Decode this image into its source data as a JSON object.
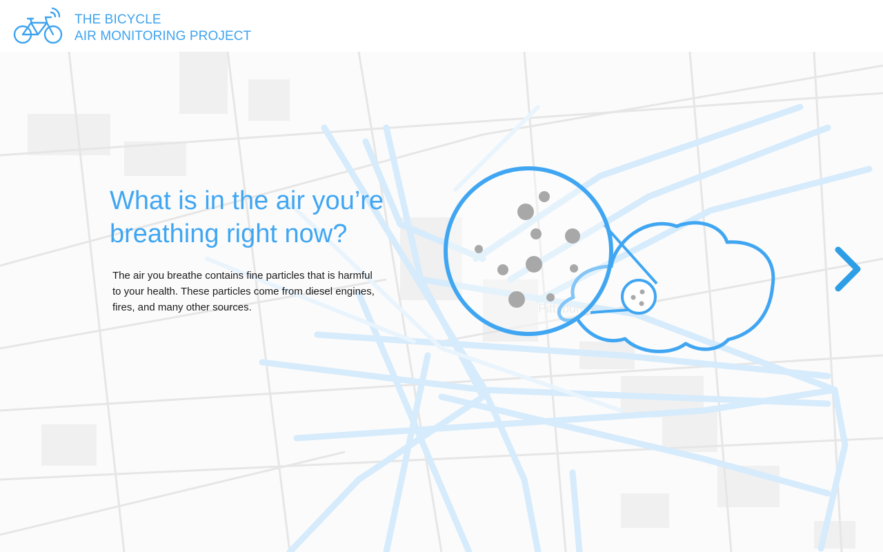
{
  "header": {
    "brand_line1": "THE BICYCLE",
    "brand_line2": "AIR MONITORING PROJECT",
    "logo_icon": "bicycle-signal-icon"
  },
  "intro": {
    "headline_line1": "What is in the air you’re",
    "headline_line2": "breathing right now?",
    "body_line1": "The air you breathe contains fine particles that is harmful",
    "body_line2": "to your health. These particles come from diesel engines,",
    "body_line3": "fires, and many other sources."
  },
  "illustration": {
    "icon": "particles-magnifier-cloud-icon"
  },
  "navigation": {
    "next_icon": "chevron-right-icon"
  },
  "map": {
    "place_label": "Pittsburgh"
  },
  "colors": {
    "accent": "#40a6f2",
    "particle": "#a8a8a8",
    "body_text": "#1a1a1a",
    "map_route": "#d8ecfb"
  }
}
